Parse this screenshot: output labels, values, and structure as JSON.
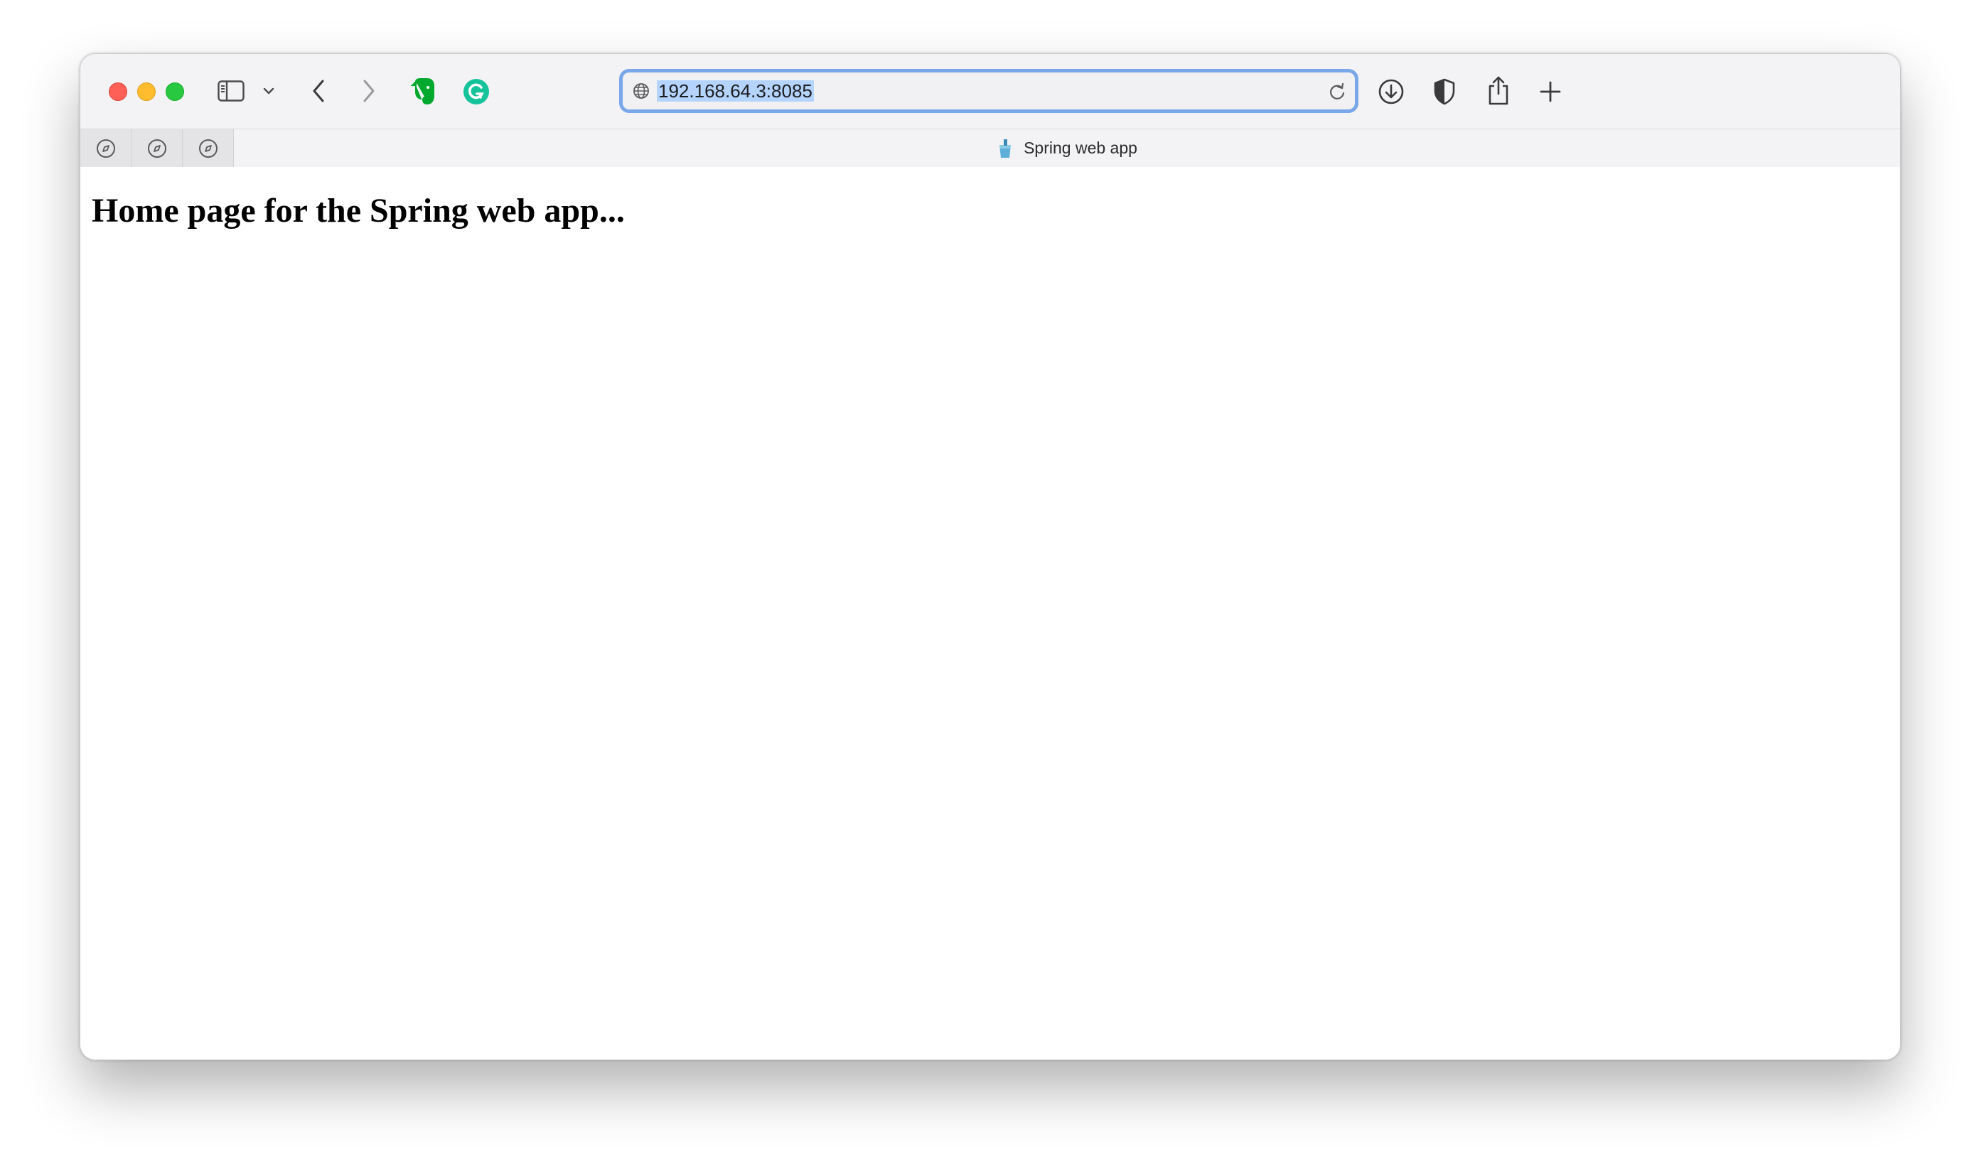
{
  "browser": {
    "address_bar": {
      "url": "192.168.64.3:8085"
    },
    "active_tab": {
      "title": "Spring web app"
    },
    "extensions": [
      "evernote-icon",
      "grammarly-icon"
    ],
    "colors": {
      "address_focus_ring": "#7aa7ea",
      "url_selection": "#b4d4fd",
      "evernote_green": "#00a82d",
      "grammarly_green": "#15c39a"
    }
  },
  "page": {
    "heading": "Home page for the Spring web app..."
  }
}
